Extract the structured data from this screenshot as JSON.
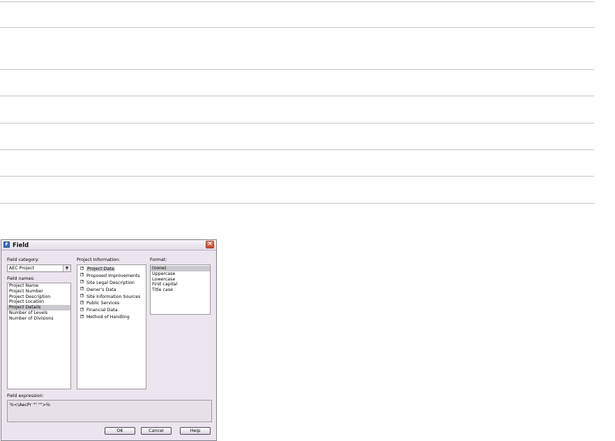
{
  "dialog": {
    "title": "Field",
    "close_glyph": "✕",
    "category_label": "Field category:",
    "category_value": "AEC Project",
    "names_label": "Field names:",
    "field_names": [
      "Project Name",
      "Project Number",
      "Project Description",
      "Project Location",
      "Project Details",
      "Number of Levels",
      "Number of Divisions"
    ],
    "selected_field_name": "Project Details",
    "info_label": "Project Information:",
    "info_items": [
      "Project Data",
      "Proposed Improvements",
      "Site Legal Description",
      "Owner's Data",
      "Site Information Sources",
      "Public Services",
      "Financial Data",
      "Method of Handling"
    ],
    "format_label": "Format:",
    "format_options": [
      "(none)",
      "Uppercase",
      "Lowercase",
      "First capital",
      "Title case"
    ],
    "selected_format": "(none)",
    "expression_label": "Field expression:",
    "expression_value": "%<\\AecPr \"\" \"\">%",
    "buttons": {
      "ok": "OK",
      "cancel": "Cancel",
      "help": "Help"
    }
  },
  "icons": {
    "app_icon": "field-app-icon",
    "close_icon": "close-icon",
    "dropdown": "chevron-down-icon",
    "expander": "plus-box-icon"
  }
}
